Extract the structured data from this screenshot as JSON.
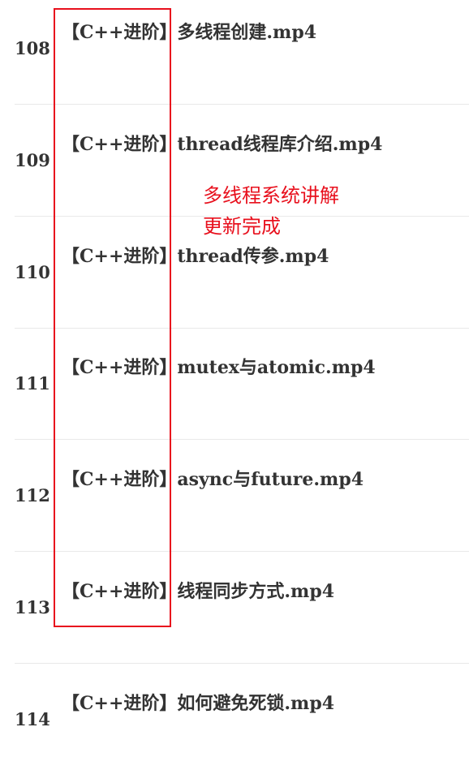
{
  "rows": [
    {
      "number": "108",
      "title": "【C++进阶】多线程创建.mp4"
    },
    {
      "number": "109",
      "title": "【C++进阶】thread线程库介绍.mp4"
    },
    {
      "number": "110",
      "title": "【C++进阶】thread传参.mp4"
    },
    {
      "number": "111",
      "title": "【C++进阶】mutex与atomic.mp4"
    },
    {
      "number": "112",
      "title": "【C++进阶】async与future.mp4"
    },
    {
      "number": "113",
      "title": "【C++进阶】线程同步方式.mp4"
    },
    {
      "number": "114",
      "title": "【C++进阶】如何避免死锁.mp4"
    }
  ],
  "annotation": {
    "line1": "多线程系统讲解",
    "line2": "更新完成",
    "color": "#e8101d"
  }
}
